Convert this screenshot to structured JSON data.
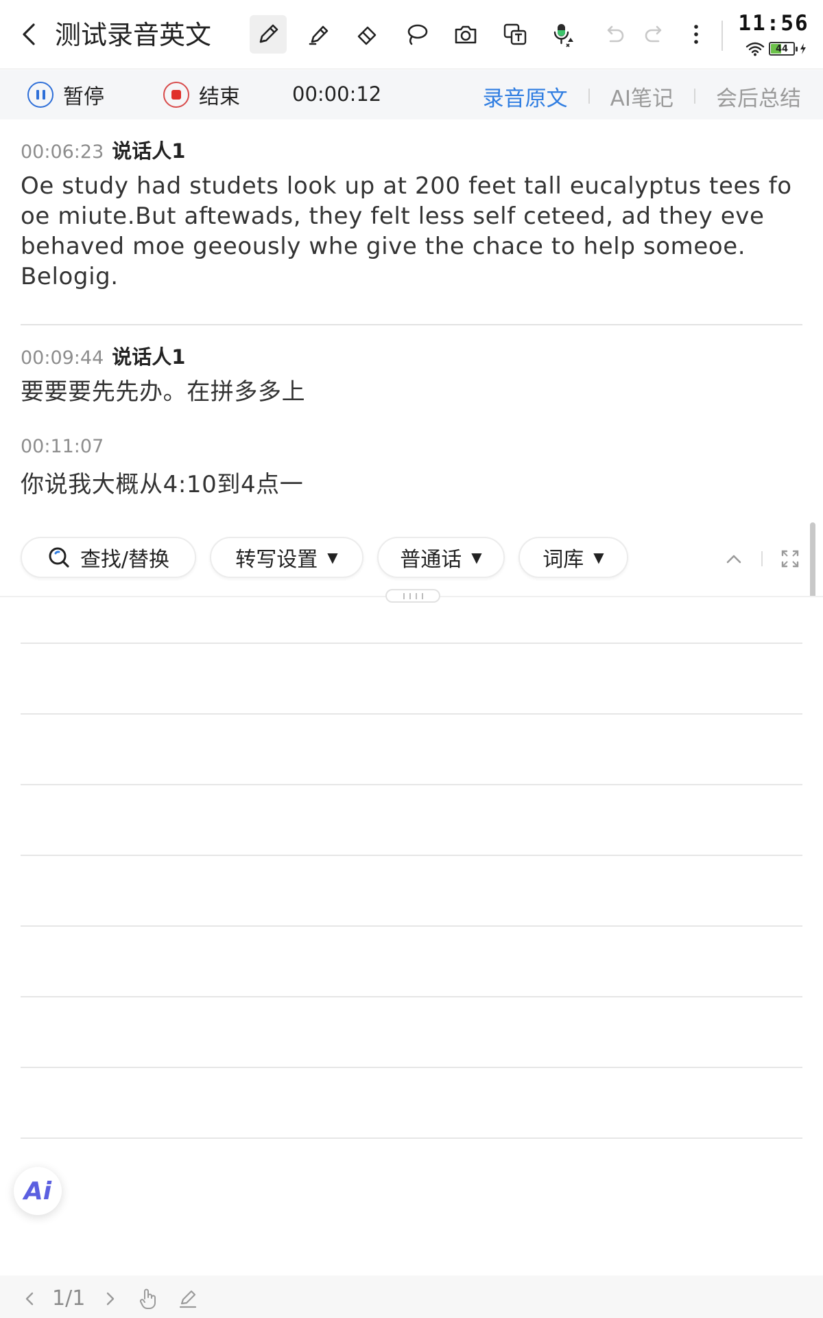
{
  "header": {
    "back_icon": "chevron-left-icon",
    "title": "测试录音英文",
    "tools": [
      "pen-icon",
      "highlighter-icon",
      "eraser-icon",
      "lasso-icon",
      "camera-icon",
      "translate-icon",
      "microphone-icon",
      "undo-icon",
      "redo-icon",
      "more-icon"
    ]
  },
  "status": {
    "time": "11:56",
    "battery_percent": "44",
    "battery_level": 0.44
  },
  "recording": {
    "pause_label": "暂停",
    "stop_label": "结束",
    "elapsed": "00:00:12",
    "tabs": [
      "录音原文",
      "AI笔记",
      "会后总结"
    ],
    "active_tab": "录音原文"
  },
  "transcript": {
    "segments": [
      {
        "time": "00:06:23",
        "speaker": "说话人1",
        "text": "Oe study had studets look up at 200 feet tall eucalyptus tees fo oe miute.But aftewads, they felt less self ceteed, ad they eve behaved moe geeously whe give the chace to help someoe. Belogig."
      },
      {
        "time": "00:09:44",
        "speaker": "说话人1",
        "text": "要要要先先办。在拼多多上"
      },
      {
        "time": "00:11:07",
        "speaker": "",
        "text": "你说我大概从4:10到4点一"
      }
    ]
  },
  "toolbar": {
    "find_label": "查找/替换",
    "transcribe_settings_label": "转写设置",
    "language_label": "普通话",
    "lexicon_label": "词库"
  },
  "ai_button_label": "Ai",
  "pager": {
    "indicator": "1/1"
  }
}
